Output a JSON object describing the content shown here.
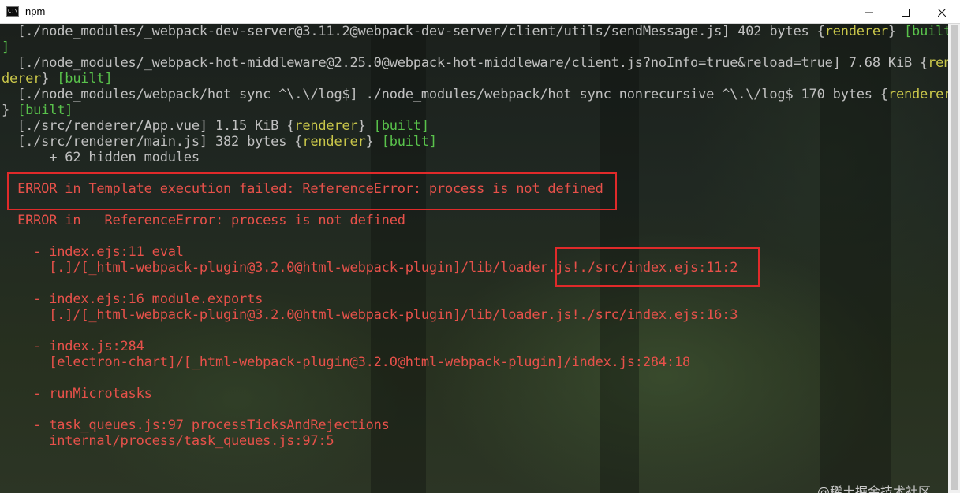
{
  "window": {
    "title": "npm",
    "icon_text": "C:\\.",
    "icon": "command-prompt-icon",
    "controls": [
      "minimize-icon",
      "maximize-icon",
      "close-icon"
    ]
  },
  "colors": {
    "normal": "#c0c0c0",
    "green": "#59c24b",
    "yellow": "#c9c64a",
    "red": "#e7514a",
    "highlight_box": "#e02a2a"
  },
  "terminal": {
    "lines": [
      [
        {
          "t": "  [./node_modules/_webpack-dev-server@3.11.2@webpack-dev-server/client/utils/sendMessage.js] 402 bytes ",
          "c": "w"
        },
        {
          "t": "{",
          "c": "w"
        },
        {
          "t": "renderer",
          "c": "y"
        },
        {
          "t": "} ",
          "c": "w"
        },
        {
          "t": "[built",
          "c": "g"
        }
      ],
      [
        {
          "t": "]",
          "c": "g"
        }
      ],
      [
        {
          "t": "  [./node_modules/_webpack-hot-middleware@2.25.0@webpack-hot-middleware/client.js?noInfo=true&reload=true] 7.68 KiB {",
          "c": "w"
        },
        {
          "t": "ren",
          "c": "y"
        }
      ],
      [
        {
          "t": "derer",
          "c": "y"
        },
        {
          "t": "} ",
          "c": "w"
        },
        {
          "t": "[built]",
          "c": "g"
        }
      ],
      [
        {
          "t": "  [./node_modules/webpack/hot sync ^\\.\\/log$] ./node_modules/webpack/hot sync nonrecursive ^\\.\\/log$ 170 bytes {",
          "c": "w"
        },
        {
          "t": "renderer",
          "c": "y"
        }
      ],
      [
        {
          "t": "} ",
          "c": "w"
        },
        {
          "t": "[built]",
          "c": "g"
        }
      ],
      [
        {
          "t": "  [./src/renderer/App.vue] 1.15 KiB {",
          "c": "w"
        },
        {
          "t": "renderer",
          "c": "y"
        },
        {
          "t": "} ",
          "c": "w"
        },
        {
          "t": "[built]",
          "c": "g"
        }
      ],
      [
        {
          "t": "  [./src/renderer/main.js] 382 bytes {",
          "c": "w"
        },
        {
          "t": "renderer",
          "c": "y"
        },
        {
          "t": "} ",
          "c": "w"
        },
        {
          "t": "[built]",
          "c": "g"
        }
      ],
      [
        {
          "t": "      + 62 hidden modules",
          "c": "w"
        }
      ],
      [],
      [
        {
          "t": "  ERROR in Template execution failed: ReferenceError: process is not defined",
          "c": "r"
        }
      ],
      [],
      [
        {
          "t": "  ERROR in   ReferenceError: process is not defined",
          "c": "r"
        }
      ],
      [],
      [
        {
          "t": "    - index.ejs:11 eval",
          "c": "r"
        }
      ],
      [
        {
          "t": "      [.]/[_html-webpack-plugin@3.2.0@html-webpack-plugin]/lib/loader.js!./src/index.ejs:11:2",
          "c": "r"
        }
      ],
      [],
      [
        {
          "t": "    - index.ejs:16 module.exports",
          "c": "r"
        }
      ],
      [
        {
          "t": "      [.]/[_html-webpack-plugin@3.2.0@html-webpack-plugin]/lib/loader.js!./src/index.ejs:16:3",
          "c": "r"
        }
      ],
      [],
      [
        {
          "t": "    - index.js:284",
          "c": "r"
        }
      ],
      [
        {
          "t": "      [electron-chart]/[_html-webpack-plugin@3.2.0@html-webpack-plugin]/index.js:284:18",
          "c": "r"
        }
      ],
      [],
      [
        {
          "t": "    - runMicrotasks",
          "c": "r"
        }
      ],
      [],
      [
        {
          "t": "    - task_queues.js:97 processTicksAndRejections",
          "c": "r"
        }
      ],
      [
        {
          "t": "      internal/process/task_queues.js:97:5",
          "c": "r"
        }
      ]
    ]
  },
  "watermark": "@稀土掘金技术社区"
}
